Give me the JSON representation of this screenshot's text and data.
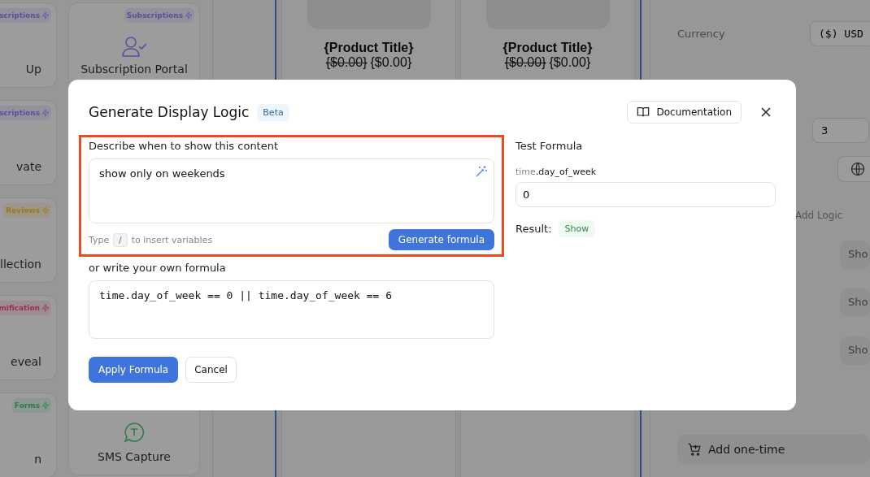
{
  "sidebar": {
    "columns": [
      [
        {
          "tag": "scriptions",
          "color": "#5a4f9c",
          "title": "Up"
        },
        {
          "tag": "scriptions",
          "color": "#5a4f9c",
          "title": "vate"
        },
        {
          "tag": "Reviews",
          "color": "#9c7a14",
          "title": "llection"
        },
        {
          "tag": "mification",
          "color": "#9c2c55",
          "title": "eveal"
        },
        {
          "tag": "Forms",
          "color": "#2a7d4c",
          "title": "n"
        }
      ],
      [
        {
          "tag": "Subscriptions",
          "color": "#5a4f9c",
          "title": "Subscription Portal"
        },
        {
          "title": "SMS Capture"
        }
      ]
    ]
  },
  "canvas": {
    "products": [
      {
        "title": "{Product Title}",
        "old_price": "{$0.00}",
        "price": "{$0.00}"
      },
      {
        "title": "{Product Title}",
        "old_price": "{$0.00}",
        "price": "{$0.00}"
      }
    ]
  },
  "settings": {
    "currency_label": "Currency",
    "currency_value": "($) USD",
    "quantity": "3",
    "add_logic": "Add Logic",
    "show_buttons": [
      "Sho",
      "Sho",
      "Sho"
    ],
    "add_button": "Add one-time"
  },
  "dialog": {
    "title": "Generate Display Logic",
    "badge": "Beta",
    "documentation": "Documentation",
    "describe": {
      "label": "Describe when to show this content",
      "value": "show only on weekends",
      "hint_before": "Type",
      "key": "/",
      "hint_after": "to insert variables",
      "button": "Generate formula",
      "highlighted": true
    },
    "formula": {
      "label": "or write your own formula",
      "value": "time.day_of_week == 0 || time.day_of_week == 6"
    },
    "test": {
      "title": "Test Formula",
      "variable": {
        "scope": "time",
        "name": ".day_of_week"
      },
      "value": "0",
      "result_label": "Result:",
      "result": "Show"
    },
    "buttons": {
      "apply": "Apply Formula",
      "cancel": "Cancel"
    }
  }
}
